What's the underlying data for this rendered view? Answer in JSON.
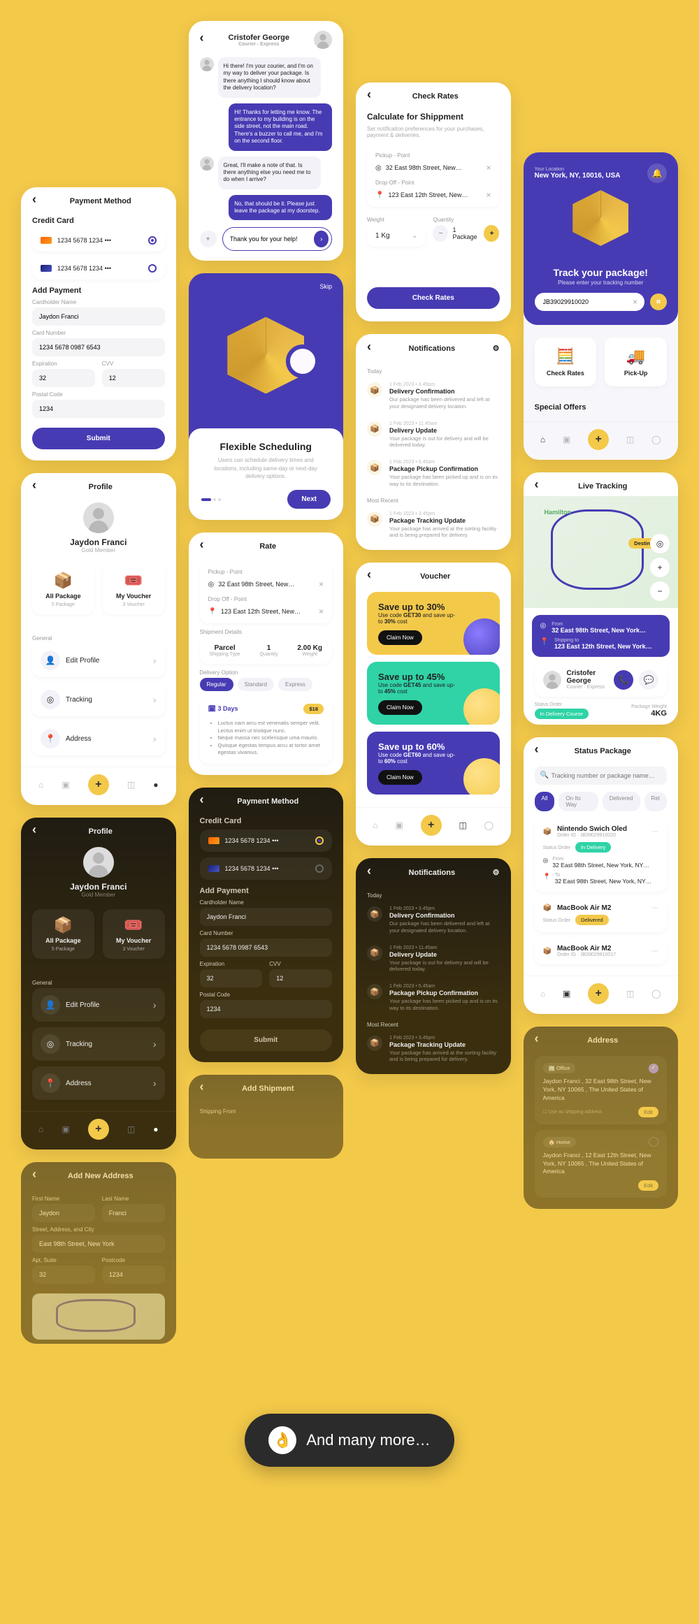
{
  "payment": {
    "title": "Payment Method",
    "credit_card": "Credit Card",
    "cards": [
      {
        "num": "1234 5678 1234 •••",
        "selected": true
      },
      {
        "num": "1234 5678 1234 •••",
        "selected": false
      }
    ],
    "add_payment": "Add Payment",
    "fields": {
      "name_label": "Cardholder Name",
      "name": "Jaydon Franci",
      "num_label": "Card Number",
      "num": "1234 5678 0987 6543",
      "exp_label": "Expiration",
      "exp": "32",
      "cvv_label": "CVV",
      "cvv": "12",
      "postal_label": "Postal Code",
      "postal": "1234"
    },
    "submit": "Submit"
  },
  "profile": {
    "title": "Profile",
    "name": "Jaydon Franci",
    "tier": "Gold Member",
    "tiles": [
      {
        "title": "All Package",
        "sub": "5 Package"
      },
      {
        "title": "My Voucher",
        "sub": "3 Voucher"
      }
    ],
    "general": "General",
    "menu": [
      {
        "label": "Edit Profile"
      },
      {
        "label": "Tracking"
      },
      {
        "label": "Address"
      }
    ]
  },
  "chat": {
    "name": "Cristofer George",
    "role": "Courier - Express",
    "msgs": [
      {
        "me": false,
        "text": "Hi there! I'm your courier, and I'm on my way to deliver your package. Is there anything I should know about the delivery location?"
      },
      {
        "me": true,
        "text": "Hi! Thanks for letting me know. The entrance to my building is on the side street, not the main road. There's a buzzer to call me, and I'm on the second floor."
      },
      {
        "me": false,
        "text": "Great, I'll make a note of that. Is there anything else you need me to do when I arrive?"
      },
      {
        "me": true,
        "text": "No, that should be it. Please just leave the package at my doorstep."
      }
    ],
    "input": "Thank you for your help!"
  },
  "onboard": {
    "skip": "Skip",
    "title": "Flexible Scheduling",
    "desc": "Users can schedule delivery times and locations, including same-day or next-day delivery options.",
    "next": "Next"
  },
  "rate": {
    "title": "Rate",
    "pickup_label": "Pickup - Point",
    "pickup": "32 East 98th Street, New…",
    "drop_label": "Drop Off - Point",
    "drop": "123 East 12th Street, New…",
    "shipment": "Shipment Details",
    "details": [
      {
        "v": "Parcel",
        "l": "Shipping Type"
      },
      {
        "v": "1",
        "l": "Quantity"
      },
      {
        "v": "2.00 Kg",
        "l": "Weight"
      }
    ],
    "delivery": "Delivery Option",
    "opts": [
      "Regular",
      "Standard",
      "Express"
    ],
    "info": {
      "days": "3 Days",
      "price": "$18",
      "bullets": [
        "Luctus nam arcu est venenatis semper velit. Lectus enim ut tristique nunc.",
        "Neque massa nec scelerisque uma mauris.",
        "Quisque egestas tempus arcu at tortor amet egestas vivamus."
      ]
    }
  },
  "check": {
    "title": "Check Rates",
    "calc": "Calculate for Shippment",
    "sub": "Set notification preferences for your purchases, payment & deliveries.",
    "pickup_label": "Pickup - Point",
    "pickup": "32 East 98th Street, New…",
    "drop_label": "Drop Off - Point",
    "drop": "123 East 12th Street, New…",
    "weight_label": "Weight",
    "weight": "1 Kg",
    "qty_label": "Quantity",
    "qty": "1 Package",
    "btn": "Check Rates"
  },
  "notif": {
    "title": "Notifications",
    "today": "Today",
    "recent": "Most Recent",
    "items": [
      {
        "ts": "1 Feb 2023 • 3.45pm",
        "t": "Delivery Confirmation",
        "d": "Our package has been delivered and left at your designated delivery location."
      },
      {
        "ts": "1 Feb 2023 • 11.45am",
        "t": "Delivery Update",
        "d": "Your package is out for delivery and will be delivered today."
      },
      {
        "ts": "1 Feb 2023 • 5.45am",
        "t": "Package Pickup Confirmation",
        "d": "Your package has been picked up and is on its way to its destination."
      }
    ],
    "recent_items": [
      {
        "ts": "1 Feb 2023 • 3.45pm",
        "t": "Package Tracking Update",
        "d": "Your package has arrived at the sorting facility and is being prepared for delivery."
      }
    ]
  },
  "voucher": {
    "title": "Voucher",
    "items": [
      {
        "bg": "#f3c94a",
        "pct": "30%",
        "code": "GET30",
        "amt": "30%"
      },
      {
        "bg": "#2fd3a6",
        "pct": "45%",
        "code": "GET45",
        "amt": "45%"
      },
      {
        "bg": "#473bb3",
        "pct": "60%",
        "code": "GET60",
        "amt": "60%"
      }
    ],
    "save": "Save up to",
    "use": "Use code",
    "tail": "and save up-",
    "to": "to",
    "cost": "cost",
    "claim": "Claim Now"
  },
  "home": {
    "loc_label": "Your Location",
    "loc": "New York, NY, 10016, USA",
    "title": "Track your package!",
    "sub": "Please enter your tracking number",
    "track": "JB39029910020",
    "tiles": [
      {
        "label": "Check Rates"
      },
      {
        "label": "Pick-Up"
      }
    ],
    "offers": "Special Offers"
  },
  "live": {
    "title": "Live Tracking",
    "dest": "Destination",
    "from_l": "From",
    "from": "32 East 98th Street, New York…",
    "to_l": "Shipping to",
    "to": "123 East 12th Street, New York…",
    "courier": "Cristofer George",
    "courier_role": "Courier · Express",
    "status_l": "Status Order",
    "status": "In Delivery Course",
    "weight_l": "Package Weight",
    "weight": "4KG"
  },
  "status": {
    "title": "Status Package",
    "search": "Tracking number or package name…",
    "filters": [
      "All",
      "On Its Way",
      "Delivered",
      "Ret"
    ],
    "pkgs": [
      {
        "name": "Nintendo Swich Oled",
        "id": "Order ID · JB39029910020",
        "status": "In Delivery",
        "from": "32 East 98th Street, New York, NY…",
        "to": "32 East 98th Street, New York, NY…",
        "badge_bg": "#2fd3a6"
      },
      {
        "name": "MacBook Air M2",
        "id": "",
        "status": "Delivered",
        "badge_bg": "#f3c94a"
      },
      {
        "name": "MacBook Air M2",
        "id": "Order ID · JB39029910017"
      }
    ],
    "from_l": "From",
    "to_l": "To",
    "status_l": "Status Order"
  },
  "addnew": {
    "title": "Add New Address",
    "first_l": "First Name",
    "first": "Jaydon",
    "last_l": "Last Name",
    "last": "Franci",
    "street_l": "Street, Address, and City",
    "street": "East 98th Street, New York",
    "apt_l": "Apt, Suite",
    "apt": "32",
    "post_l": "Postcode",
    "post": "1234"
  },
  "addship": {
    "title": "Add Shipment",
    "from_l": "Shipping From"
  },
  "address": {
    "title": "Address",
    "edit": "Edit",
    "items": [
      {
        "tag": "Office",
        "sel": true,
        "text": "Jaydon Franci , 32 East 98th Street, New York, NY 10065 , The United States of America",
        "cb": "Use as shipping address"
      },
      {
        "tag": "Home",
        "sel": false,
        "text": "Jaydon Franci , 12 East 12th Street, New York, NY 10065 , The United States of America"
      }
    ]
  },
  "more": "And many more…"
}
